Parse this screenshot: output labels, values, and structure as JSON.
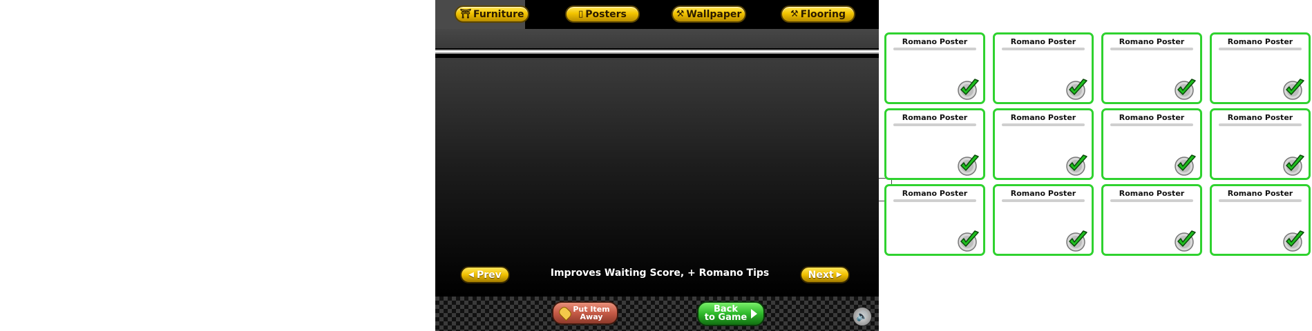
{
  "game": {
    "tabs": [
      {
        "label": "Furniture",
        "icon": "table-icon"
      },
      {
        "label": "Posters",
        "icon": "poster-icon"
      },
      {
        "label": "Wallpaper",
        "icon": "paint-roller-icon"
      },
      {
        "label": "Flooring",
        "icon": "hammer-icon"
      }
    ],
    "prev_label": "Prev",
    "next_label": "Next",
    "tips_text": "Improves Waiting Score, + Romano Tips",
    "put_away_line1": "Put Item",
    "put_away_line2": "Away",
    "back_line1": "Back",
    "back_line2": "to Game",
    "sound_icon": "speaker-icon"
  },
  "posters": {
    "rows": 3,
    "cols": 4,
    "items": [
      {
        "title": "Romano Poster",
        "owned": true
      },
      {
        "title": "Romano Poster",
        "owned": true
      },
      {
        "title": "Romano Poster",
        "owned": true
      },
      {
        "title": "Romano Poster",
        "owned": true
      },
      {
        "title": "Romano Poster",
        "owned": true
      },
      {
        "title": "Romano Poster",
        "owned": true
      },
      {
        "title": "Romano Poster",
        "owned": true
      },
      {
        "title": "Romano Poster",
        "owned": true
      },
      {
        "title": "Romano Poster",
        "owned": true
      },
      {
        "title": "Romano Poster",
        "owned": true
      },
      {
        "title": "Romano Poster",
        "owned": true
      },
      {
        "title": "Romano Poster",
        "owned": true
      }
    ]
  },
  "colors": {
    "card_border": "#2fd22f",
    "button_gold": "#f3c400",
    "button_green": "#2db82a",
    "button_red": "#c55a46"
  }
}
